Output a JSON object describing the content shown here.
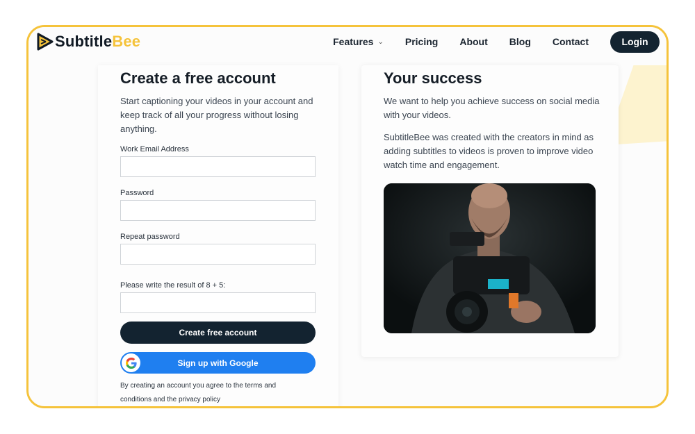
{
  "header": {
    "logo": {
      "text_main": "Subtitle",
      "text_accent": "Bee"
    },
    "nav": [
      {
        "label": "Features",
        "has_dropdown": true
      },
      {
        "label": "Pricing"
      },
      {
        "label": "About"
      },
      {
        "label": "Blog"
      },
      {
        "label": "Contact"
      }
    ],
    "login_label": "Login"
  },
  "signup": {
    "title": "Create a free account",
    "intro": "Start captioning your videos in your account and keep track of all your progress without losing anything.",
    "fields": {
      "email_label": "Work Email Address",
      "email_value": "",
      "password_label": "Password",
      "password_value": "",
      "repeat_label": "Repeat password",
      "repeat_value": "",
      "captcha_label": "Please write the result of 8 + 5:",
      "captcha_value": ""
    },
    "create_button": "Create free account",
    "google_button": "Sign up with Google",
    "terms": "By creating an account you agree to the terms and conditions and the privacy policy"
  },
  "success": {
    "title": "Your success",
    "paragraph1": "We want to help you achieve success on social media with your videos.",
    "paragraph2": "SubtitleBee was created with the creators in mind as adding subtitles to videos is proven to improve video watch time and engagement."
  },
  "colors": {
    "accent": "#f5c33b",
    "dark": "#132330",
    "google_blue": "#1f7ff0"
  }
}
